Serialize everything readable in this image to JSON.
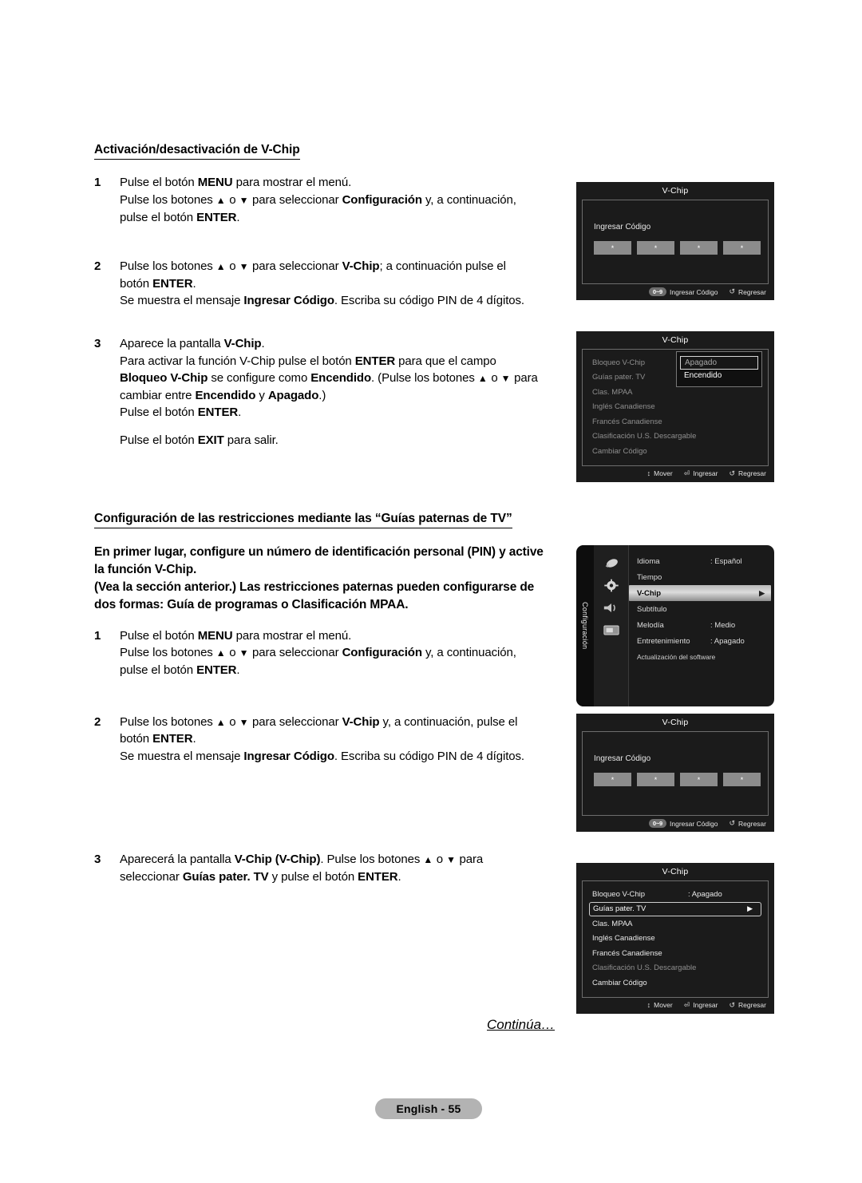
{
  "document": {
    "continues_label": "Continúa…",
    "page_label": "English - 55"
  },
  "sections": [
    {
      "heading": "Activación/desactivación de V-Chip",
      "steps": [
        {
          "num": "1",
          "lines": [
            "Pulse el botón MENU para mostrar el menú.",
            "Pulse los botones ▲ o ▼ para seleccionar Configuración y, a continuación,",
            "pulse el botón ENTER."
          ]
        },
        {
          "num": "2",
          "lines": [
            "Pulse los botones ▲ o ▼ para seleccionar V-Chip; a continuación pulse el",
            "botón ENTER.",
            "Se muestra el mensaje Ingresar Código. Escriba su código PIN de 4 dígitos."
          ]
        },
        {
          "num": "3",
          "lines": [
            "Aparece la pantalla V-Chip.",
            "Para activar la función V-Chip pulse el botón ENTER para que el campo",
            "Bloqueo V-Chip se configure como Encendido. (Pulse los botones ▲ o ▼ para",
            "cambiar entre Encendido y Apagado.)",
            "Pulse el botón ENTER.",
            "",
            "Pulse el botón EXIT para salir."
          ]
        }
      ]
    },
    {
      "heading": "Configuración de las restricciones mediante las “Guías paternas de TV”",
      "lead": [
        "En primer lugar, configure un número de identificación personal (PIN) y active",
        "la función V-Chip.",
        "(Vea la sección anterior.) Las restricciones paternas pueden configurarse de",
        "dos formas: Guía de programas o Clasificación MPAA."
      ],
      "steps": [
        {
          "num": "1",
          "lines": [
            "Pulse el botón MENU para mostrar el menú.",
            "Pulse los botones ▲ o ▼ para seleccionar Configuración y, a continuación,",
            "pulse el botón ENTER."
          ]
        },
        {
          "num": "2",
          "lines": [
            "Pulse los botones ▲ o ▼ para seleccionar V-Chip y, a continuación, pulse el",
            "botón ENTER.",
            "Se muestra el mensaje Ingresar Código. Escriba su código PIN de 4 dígitos."
          ]
        },
        {
          "num": "3",
          "lines": [
            "Aparecerá la pantalla V-Chip (V-Chip). Pulse los botones ▲ o ▼ para",
            "seleccionar Guías pater. TV y pulse el botón ENTER."
          ]
        }
      ]
    }
  ],
  "screens": {
    "pin1": {
      "title": "V-Chip",
      "prompt": "Ingresar Código",
      "digits": [
        "*",
        "*",
        "*",
        "*"
      ],
      "footer": [
        {
          "key": "0~9",
          "label": "Ingresar Código"
        },
        {
          "glyph": "↺",
          "label": "Regresar"
        }
      ]
    },
    "vchip_dropdown": {
      "title": "V-Chip",
      "rows": [
        {
          "label": "Bloqueo V-Chip",
          "value": ":"
        },
        {
          "label": "Guías pater. TV",
          "value": ""
        },
        {
          "label": "Clas. MPAA",
          "value": ""
        },
        {
          "label": "Inglés Canadiense",
          "value": ""
        },
        {
          "label": "Francés Canadiense",
          "value": ""
        },
        {
          "label": "Clasificación U.S. Descargable",
          "value": ""
        },
        {
          "label": "Cambiar Código",
          "value": ""
        }
      ],
      "dropdown": {
        "options": [
          "Apagado",
          "Encendido"
        ],
        "selected": "Apagado"
      },
      "footer": [
        {
          "glyph": "↕",
          "label": "Mover"
        },
        {
          "glyph": "⏎",
          "label": "Ingresar"
        },
        {
          "glyph": "↺",
          "label": "Regresar"
        }
      ]
    },
    "setup_menu": {
      "tab_label": "Configuración",
      "icons": [
        "picture-icon",
        "gear-icon",
        "sound-icon",
        "input-icon"
      ],
      "rows": [
        {
          "label": "Idioma",
          "value": ": Español",
          "state": "normal"
        },
        {
          "label": "Tiempo",
          "value": "",
          "state": "normal"
        },
        {
          "label": "V-Chip",
          "value": "",
          "state": "highlighted",
          "caret": "▶"
        },
        {
          "label": "Subtítulo",
          "value": "",
          "state": "normal"
        },
        {
          "label": "Melodía",
          "value": ": Medio",
          "state": "normal"
        },
        {
          "label": "Entretenimiento",
          "value": ": Apagado",
          "state": "normal"
        },
        {
          "label": "Actualización del software",
          "value": "",
          "state": "small"
        }
      ]
    },
    "pin2": {
      "title": "V-Chip",
      "prompt": "Ingresar Código",
      "digits": [
        "*",
        "*",
        "*",
        "*"
      ],
      "footer": [
        {
          "key": "0~9",
          "label": "Ingresar Código"
        },
        {
          "glyph": "↺",
          "label": "Regresar"
        }
      ]
    },
    "vchip_list": {
      "title": "V-Chip",
      "rows": [
        {
          "label": "Bloqueo V-Chip",
          "value": ": Apagado",
          "state": "bright"
        },
        {
          "label": "Guías pater. TV",
          "value": "",
          "state": "selected",
          "caret": "▶"
        },
        {
          "label": "Clas. MPAA",
          "value": "",
          "state": "bright"
        },
        {
          "label": "Inglés Canadiense",
          "value": "",
          "state": "bright"
        },
        {
          "label": "Francés Canadiense",
          "value": "",
          "state": "bright"
        },
        {
          "label": "Clasificación U.S. Descargable",
          "value": "",
          "state": "dim"
        },
        {
          "label": "Cambiar Código",
          "value": "",
          "state": "bright"
        }
      ],
      "footer": [
        {
          "glyph": "↕",
          "label": "Mover"
        },
        {
          "glyph": "⏎",
          "label": "Ingresar"
        },
        {
          "glyph": "↺",
          "label": "Regresar"
        }
      ]
    }
  }
}
